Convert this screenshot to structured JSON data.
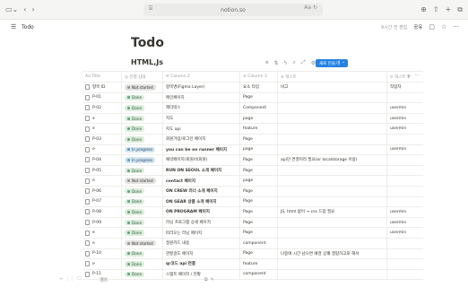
{
  "browser": {
    "url": "notion.so",
    "reader": "Aa ↻"
  },
  "topbar": {
    "title": "Todo",
    "edited": "9시간 전 편집",
    "share": "공유"
  },
  "page": {
    "title": "Todo",
    "view_title": "HTML,Js"
  },
  "toolbar": {
    "new_label": "새로 만들기",
    "new_arrow": "⌄"
  },
  "table": {
    "headers": [
      "Aa Title",
      "◎ 진행 상태",
      "≡ Column 2",
      "≡ Column 3",
      "≡ 텍스트",
      "≡ 텍스트 1"
    ],
    "rows": [
      {
        "title": "항목 ID",
        "status": "Not started",
        "status_type": "notstarted",
        "col2": "항목명(Figma Layer)",
        "col2_bold": false,
        "col3": "요소 타입",
        "text": "비고",
        "text1": "작업자"
      },
      {
        "title": "P-01",
        "status": "Done",
        "status_type": "done",
        "col2": "메인페이지",
        "col2_bold": false,
        "col3": "Page",
        "text": "",
        "text1": ""
      },
      {
        "title": "P-02",
        "status": "Done",
        "status_type": "done",
        "col2": "헤더박스",
        "col2_bold": false,
        "col3": "Component",
        "text": "",
        "text1": "usermin"
      },
      {
        "title": "e",
        "status": "Done",
        "status_type": "done",
        "col2": "지도",
        "col2_bold": false,
        "col3": "page",
        "text": "",
        "text1": "usermin"
      },
      {
        "title": "e",
        "status": "Done",
        "status_type": "done",
        "col2": "지도 api",
        "col2_bold": false,
        "col3": "feature",
        "text": "",
        "text1": "usermin"
      },
      {
        "title": "P-03",
        "status": "Done",
        "status_type": "done",
        "col2": "회원가입/로그인 페이지",
        "col2_bold": false,
        "col3": "Page",
        "text": "",
        "text1": ""
      },
      {
        "title": "e",
        "status": "In progress",
        "status_type": "inprogress",
        "col2": "you can be on runner 페이지",
        "col2_bold": true,
        "col3": "page",
        "text": "",
        "text1": "usermin"
      },
      {
        "title": "P-04",
        "status": "In progress",
        "status_type": "inprogress",
        "col2": "예약페이지(회원/비회원)",
        "col2_bold": false,
        "col3": "Page",
        "text": "api던 연결이라 필요(or localstorage 이용)",
        "text1": ""
      },
      {
        "title": "P-05",
        "status": "Done",
        "status_type": "done",
        "col2": "RUN ON SEOUL 소개 페이지",
        "col2_bold": true,
        "col3": "Page",
        "text": "",
        "text1": ""
      },
      {
        "title": "e",
        "status": "Not started",
        "status_type": "notstarted",
        "col2": "contact 페이지",
        "col2_bold": true,
        "col3": "page",
        "text": "",
        "text1": ""
      },
      {
        "title": "P-06",
        "status": "Done",
        "status_type": "done",
        "col2": "ON CREW 러너 소개 페이지",
        "col2_bold": true,
        "col3": "Page",
        "text": "",
        "text1": ""
      },
      {
        "title": "P-07",
        "status": "Done",
        "status_type": "done",
        "col2": "ON GEAR 상품 소개 페이지",
        "col2_bold": true,
        "col3": "Page",
        "text": "",
        "text1": ""
      },
      {
        "title": "P-08",
        "status": "Done",
        "status_type": "done",
        "col2": "ON PROGRAM 페이지",
        "col2_bold": true,
        "col3": "Page",
        "text": "JS, html 없이 → css 드랍 필요",
        "text1": "usermin"
      },
      {
        "title": "P-09",
        "status": "Done",
        "status_type": "done",
        "col2": "러닝 프로그램 상세 페이지",
        "col2_bold": false,
        "col3": "Page",
        "text": "",
        "text1": "usermin"
      },
      {
        "title": "e",
        "status": "Done",
        "status_type": "done",
        "col2": "따라오는 러닝 페이지",
        "col2_bold": false,
        "col3": "Page",
        "text": "",
        "text1": "usermin"
      },
      {
        "title": "e",
        "status": "Not started",
        "status_type": "notstarted",
        "col2": "정원카드 내용",
        "col2_bold": false,
        "col3": "component",
        "text": "",
        "text1": ""
      },
      {
        "title": "P-10",
        "status": "Done",
        "status_type": "done",
        "col2": "관할걸도 페이지",
        "col2_bold": false,
        "col3": "Page",
        "text": "나중에 시간 남으면 배경 상쾌 결합하고로 해서",
        "text1": ""
      },
      {
        "title": "e",
        "status": "Done",
        "status_type": "done",
        "col2": "qr코드 api 연결",
        "col2_bold": true,
        "col3": "feature",
        "text": "",
        "text1": ""
      },
      {
        "title": "P-11",
        "status": "Done",
        "status_type": "done",
        "col2": "스탬프 페이지 / 현황",
        "col2_bold": false,
        "col3": "component",
        "text": "",
        "text1": ""
      }
    ]
  },
  "row_hover": {
    "open_label": "열기"
  }
}
